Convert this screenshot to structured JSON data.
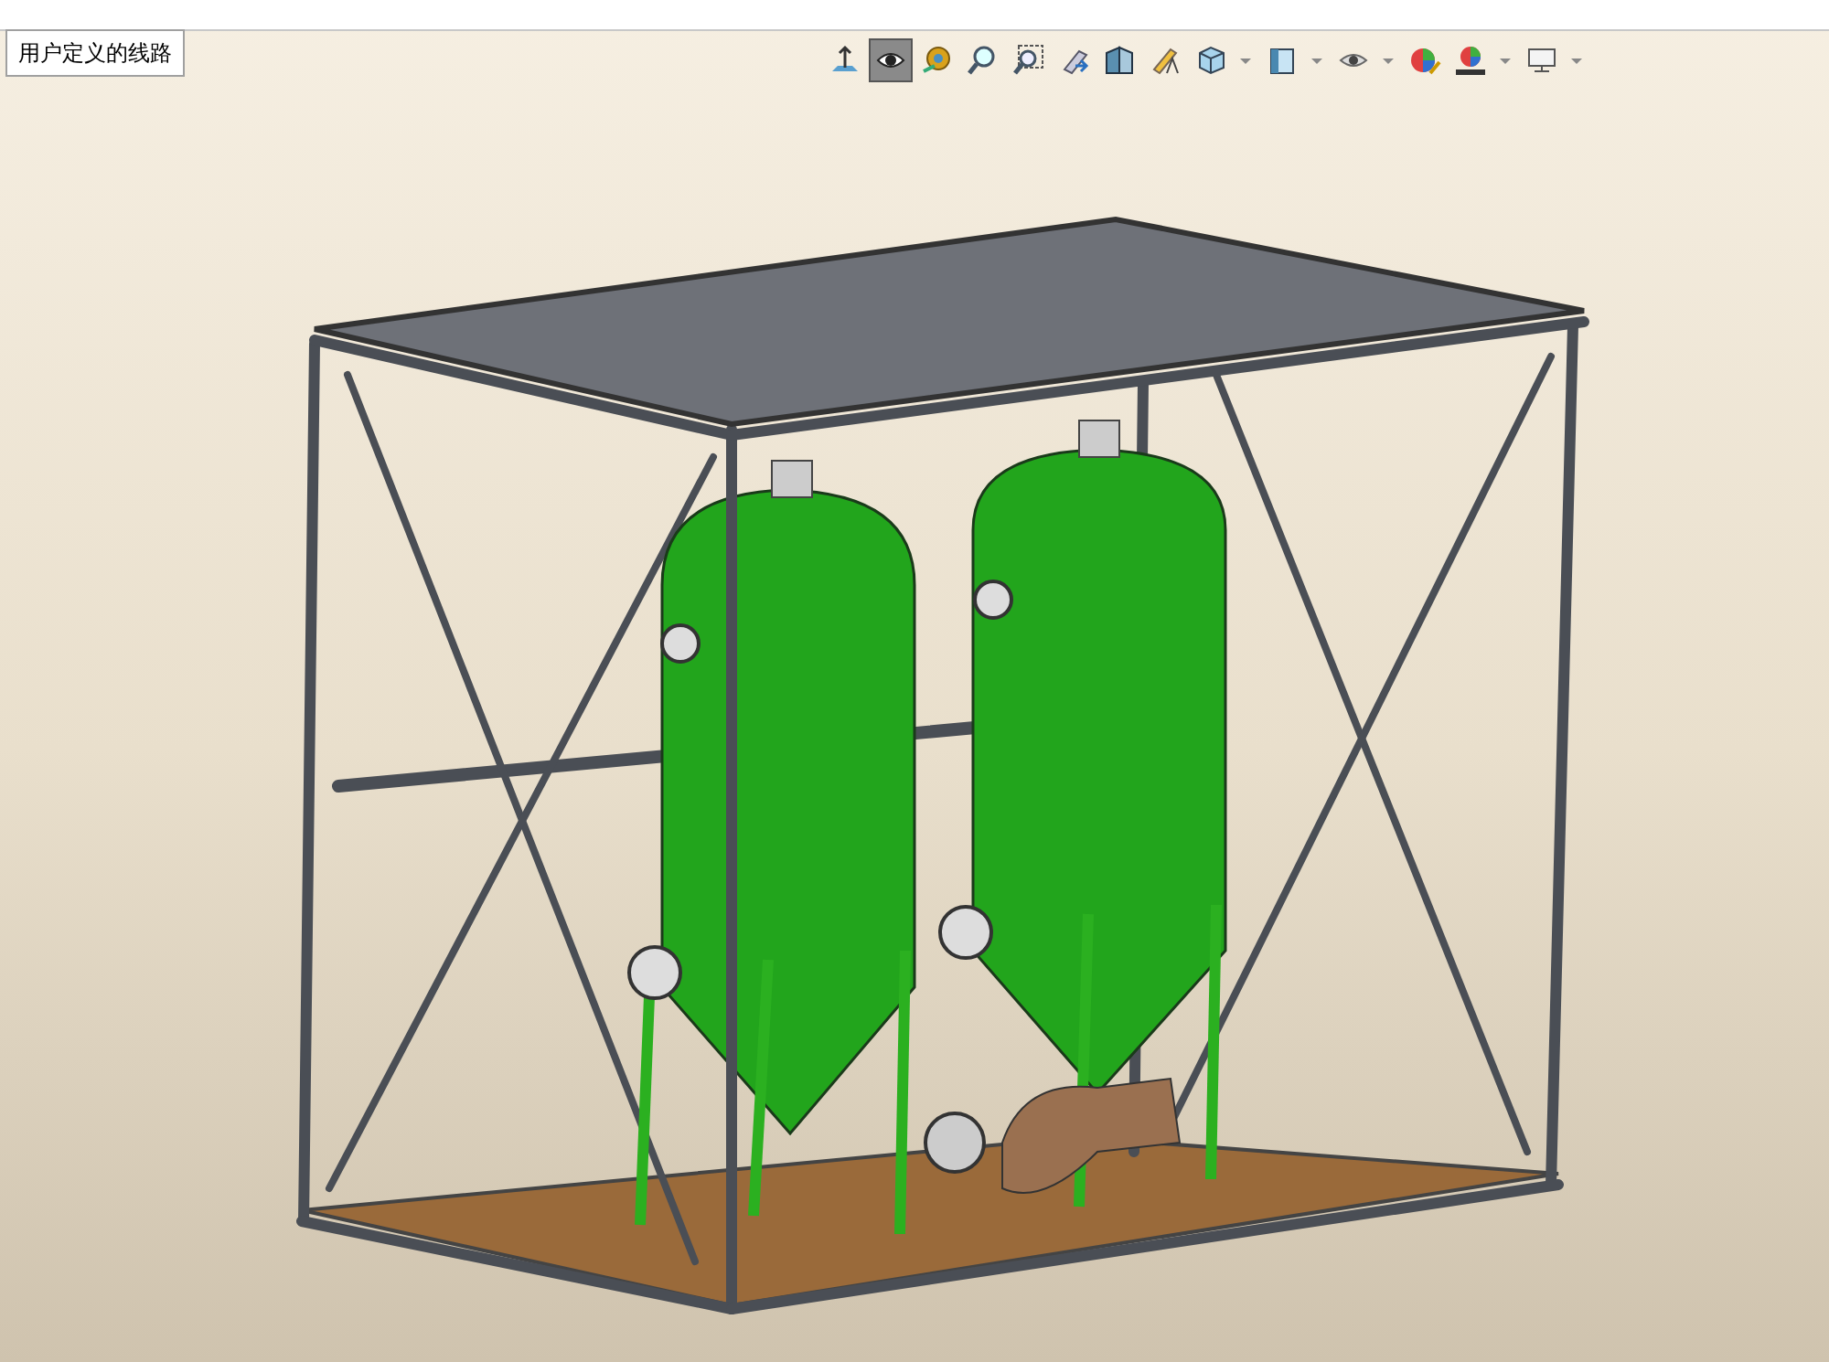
{
  "view_tab": {
    "label": "用户定义的线路",
    "selected": true
  },
  "toolbar": [
    {
      "kind": "normal-to",
      "selected": false,
      "dropdown": false
    },
    {
      "kind": "rotate",
      "selected": true,
      "dropdown": false
    },
    {
      "kind": "measure",
      "selected": false,
      "dropdown": false
    },
    {
      "kind": "zoom",
      "selected": false,
      "dropdown": false
    },
    {
      "kind": "zoom-area",
      "selected": false,
      "dropdown": false
    },
    {
      "kind": "previous",
      "selected": false,
      "dropdown": false
    },
    {
      "kind": "section",
      "selected": false,
      "dropdown": false
    },
    {
      "kind": "annotation",
      "selected": false,
      "dropdown": false
    },
    {
      "kind": "cube",
      "selected": false,
      "dropdown": true
    },
    {
      "kind": "display",
      "selected": false,
      "dropdown": true
    },
    {
      "kind": "eye",
      "selected": false,
      "dropdown": true
    },
    {
      "kind": "appearance",
      "selected": false,
      "dropdown": false
    },
    {
      "kind": "scene",
      "selected": false,
      "dropdown": true
    },
    {
      "kind": "monitor",
      "selected": false,
      "dropdown": true
    }
  ]
}
